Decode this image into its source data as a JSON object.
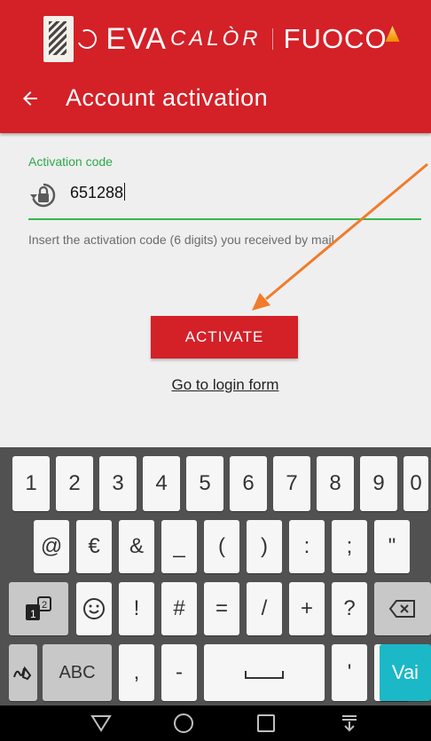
{
  "header": {
    "brand": {
      "eva": "EVA",
      "calor": "CALÒR",
      "fuoco": "FUOCO"
    },
    "title": "Account activation",
    "back_icon": "arrow-left-icon"
  },
  "form": {
    "label": "Activation code",
    "value": "651288",
    "helper": "Insert the activation code (6 digits) you received by mail",
    "icon": "lock-reset-icon"
  },
  "actions": {
    "activate_label": "ACTIVATE",
    "login_link": "Go to login form"
  },
  "keyboard": {
    "row1": [
      "1",
      "2",
      "3",
      "4",
      "5",
      "6",
      "7",
      "8",
      "9",
      "0"
    ],
    "row2": [
      "@",
      "€",
      "&",
      "_",
      "(",
      ")",
      ":",
      ";",
      "\""
    ],
    "row3": [
      "!",
      "#",
      "=",
      "/",
      "+",
      "?"
    ],
    "abc_label": "ABC",
    "comma": ",",
    "dash": "-",
    "apostrophe": "'",
    "period": ".",
    "enter_label": "Vai"
  },
  "colors": {
    "primary": "#d42027",
    "accent": "#35b94d",
    "enter": "#1bb8c7",
    "annotation_arrow": "#f07b2b"
  }
}
